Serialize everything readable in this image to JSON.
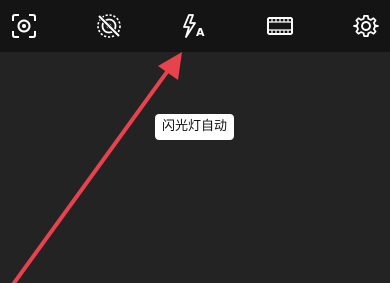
{
  "toolbar": {
    "items": [
      {
        "icon": "portrait-focus-icon"
      },
      {
        "icon": "live-photo-off-icon"
      },
      {
        "icon": "flash-auto-icon",
        "label": "A"
      },
      {
        "icon": "film-frame-icon"
      },
      {
        "icon": "gear-icon"
      }
    ]
  },
  "tooltip": {
    "text": "闪光灯自动"
  },
  "colors": {
    "toolbar_bg": "#141414",
    "screen_bg": "#232323",
    "icon": "#ffffff",
    "tooltip_bg": "#ffffff",
    "annotation_arrow": "#e8424e"
  }
}
